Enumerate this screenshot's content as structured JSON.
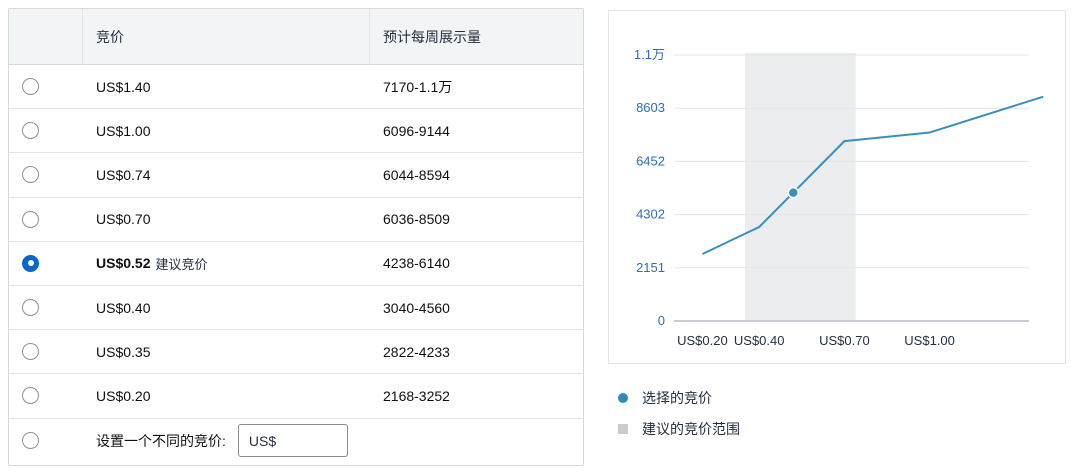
{
  "table": {
    "header": {
      "bid": "竞价",
      "impressions": "预计每周展示量"
    },
    "rows": [
      {
        "bid": "US$1.40",
        "impressions": "7170-1.1万",
        "selected": false
      },
      {
        "bid": "US$1.00",
        "impressions": "6096-9144",
        "selected": false
      },
      {
        "bid": "US$0.74",
        "impressions": "6044-8594",
        "selected": false
      },
      {
        "bid": "US$0.70",
        "impressions": "6036-8509",
        "selected": false
      },
      {
        "bid": "US$0.52",
        "tag": "建议竞价",
        "impressions": "4238-6140",
        "selected": true
      },
      {
        "bid": "US$0.40",
        "impressions": "3040-4560",
        "selected": false
      },
      {
        "bid": "US$0.35",
        "impressions": "2822-4233",
        "selected": false
      },
      {
        "bid": "US$0.20",
        "impressions": "2168-3252",
        "selected": false
      }
    ],
    "custom": {
      "label": "设置一个不同的竞价:",
      "input_value": "US$"
    }
  },
  "legend": {
    "selected_bid": "选择的竞价",
    "suggested_range": "建议的竞价范围"
  },
  "colors": {
    "line": "#3a8fc0",
    "range_band": "#ebedef",
    "radio_selected": "#0a66cc",
    "y_tick": "#2e6fb5"
  },
  "chart_data": {
    "type": "line",
    "y_ticks": [
      "0",
      "2151",
      "4302",
      "6452",
      "8603",
      "1.1万"
    ],
    "y_tick_values": [
      0,
      2151,
      4302,
      6452,
      8603,
      10754
    ],
    "x_ticks": [
      "US$0.20",
      "US$0.40",
      "US$0.70",
      "US$1.00"
    ],
    "x_tick_values": [
      0.2,
      0.4,
      0.7,
      1.0
    ],
    "xlim": [
      0.1,
      1.35
    ],
    "ylim": [
      0,
      10754
    ],
    "series": [
      {
        "x": [
          0.2,
          0.35,
          0.4,
          0.52,
          0.7,
          0.74,
          1.0,
          1.4
        ],
        "y": [
          2710,
          3528,
          3800,
          5189,
          7272,
          7319,
          7620,
          9070
        ]
      }
    ],
    "selected_point": {
      "x": 0.52,
      "y": 5189
    },
    "suggested_range": [
      0.35,
      0.74
    ],
    "grid": true
  }
}
